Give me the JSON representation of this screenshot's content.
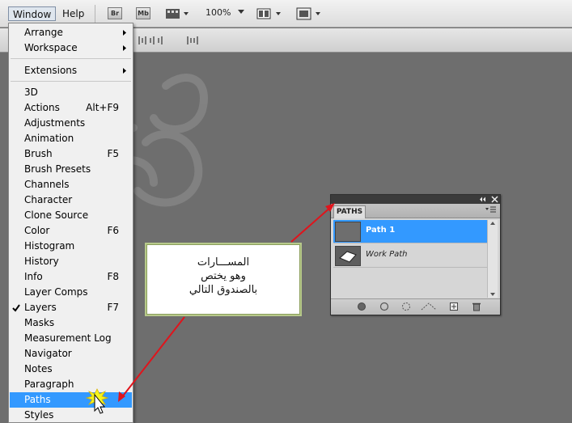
{
  "menubar": {
    "window_label": "Window",
    "help_label": "Help",
    "br_label": "Br",
    "mb_label": "Mb",
    "zoom": "100%"
  },
  "window_menu": {
    "items": [
      {
        "label": "Arrange",
        "shortcut": "",
        "submenu": true
      },
      {
        "label": "Workspace",
        "shortcut": "",
        "submenu": true
      },
      {
        "label": "Extensions",
        "shortcut": "",
        "submenu": true
      },
      {
        "label": "3D",
        "shortcut": ""
      },
      {
        "label": "Actions",
        "shortcut": "Alt+F9"
      },
      {
        "label": "Adjustments",
        "shortcut": ""
      },
      {
        "label": "Animation",
        "shortcut": ""
      },
      {
        "label": "Brush",
        "shortcut": "F5"
      },
      {
        "label": "Brush Presets",
        "shortcut": ""
      },
      {
        "label": "Channels",
        "shortcut": ""
      },
      {
        "label": "Character",
        "shortcut": ""
      },
      {
        "label": "Clone Source",
        "shortcut": ""
      },
      {
        "label": "Color",
        "shortcut": "F6"
      },
      {
        "label": "Histogram",
        "shortcut": ""
      },
      {
        "label": "History",
        "shortcut": ""
      },
      {
        "label": "Info",
        "shortcut": "F8"
      },
      {
        "label": "Layer Comps",
        "shortcut": ""
      },
      {
        "label": "Layers",
        "shortcut": "F7",
        "checked": true
      },
      {
        "label": "Masks",
        "shortcut": ""
      },
      {
        "label": "Measurement Log",
        "shortcut": ""
      },
      {
        "label": "Navigator",
        "shortcut": ""
      },
      {
        "label": "Notes",
        "shortcut": ""
      },
      {
        "label": "Paragraph",
        "shortcut": ""
      },
      {
        "label": "Paths",
        "shortcut": "",
        "highlighted": true
      },
      {
        "label": "Styles",
        "shortcut": ""
      }
    ]
  },
  "paths_panel": {
    "tab_label": "PATHS",
    "rows": [
      {
        "name": "Path 1",
        "selected": true
      },
      {
        "name": "Work Path",
        "selected": false
      }
    ]
  },
  "callout": {
    "line1": "المســـارات",
    "line2": "وهو يختص",
    "line3": "بالصندوق التالي"
  },
  "colors": {
    "highlight": "#3399ff",
    "canvas": "#6e6e6e",
    "arrow": "#e0141c",
    "callout_border": "#b7c98b"
  }
}
